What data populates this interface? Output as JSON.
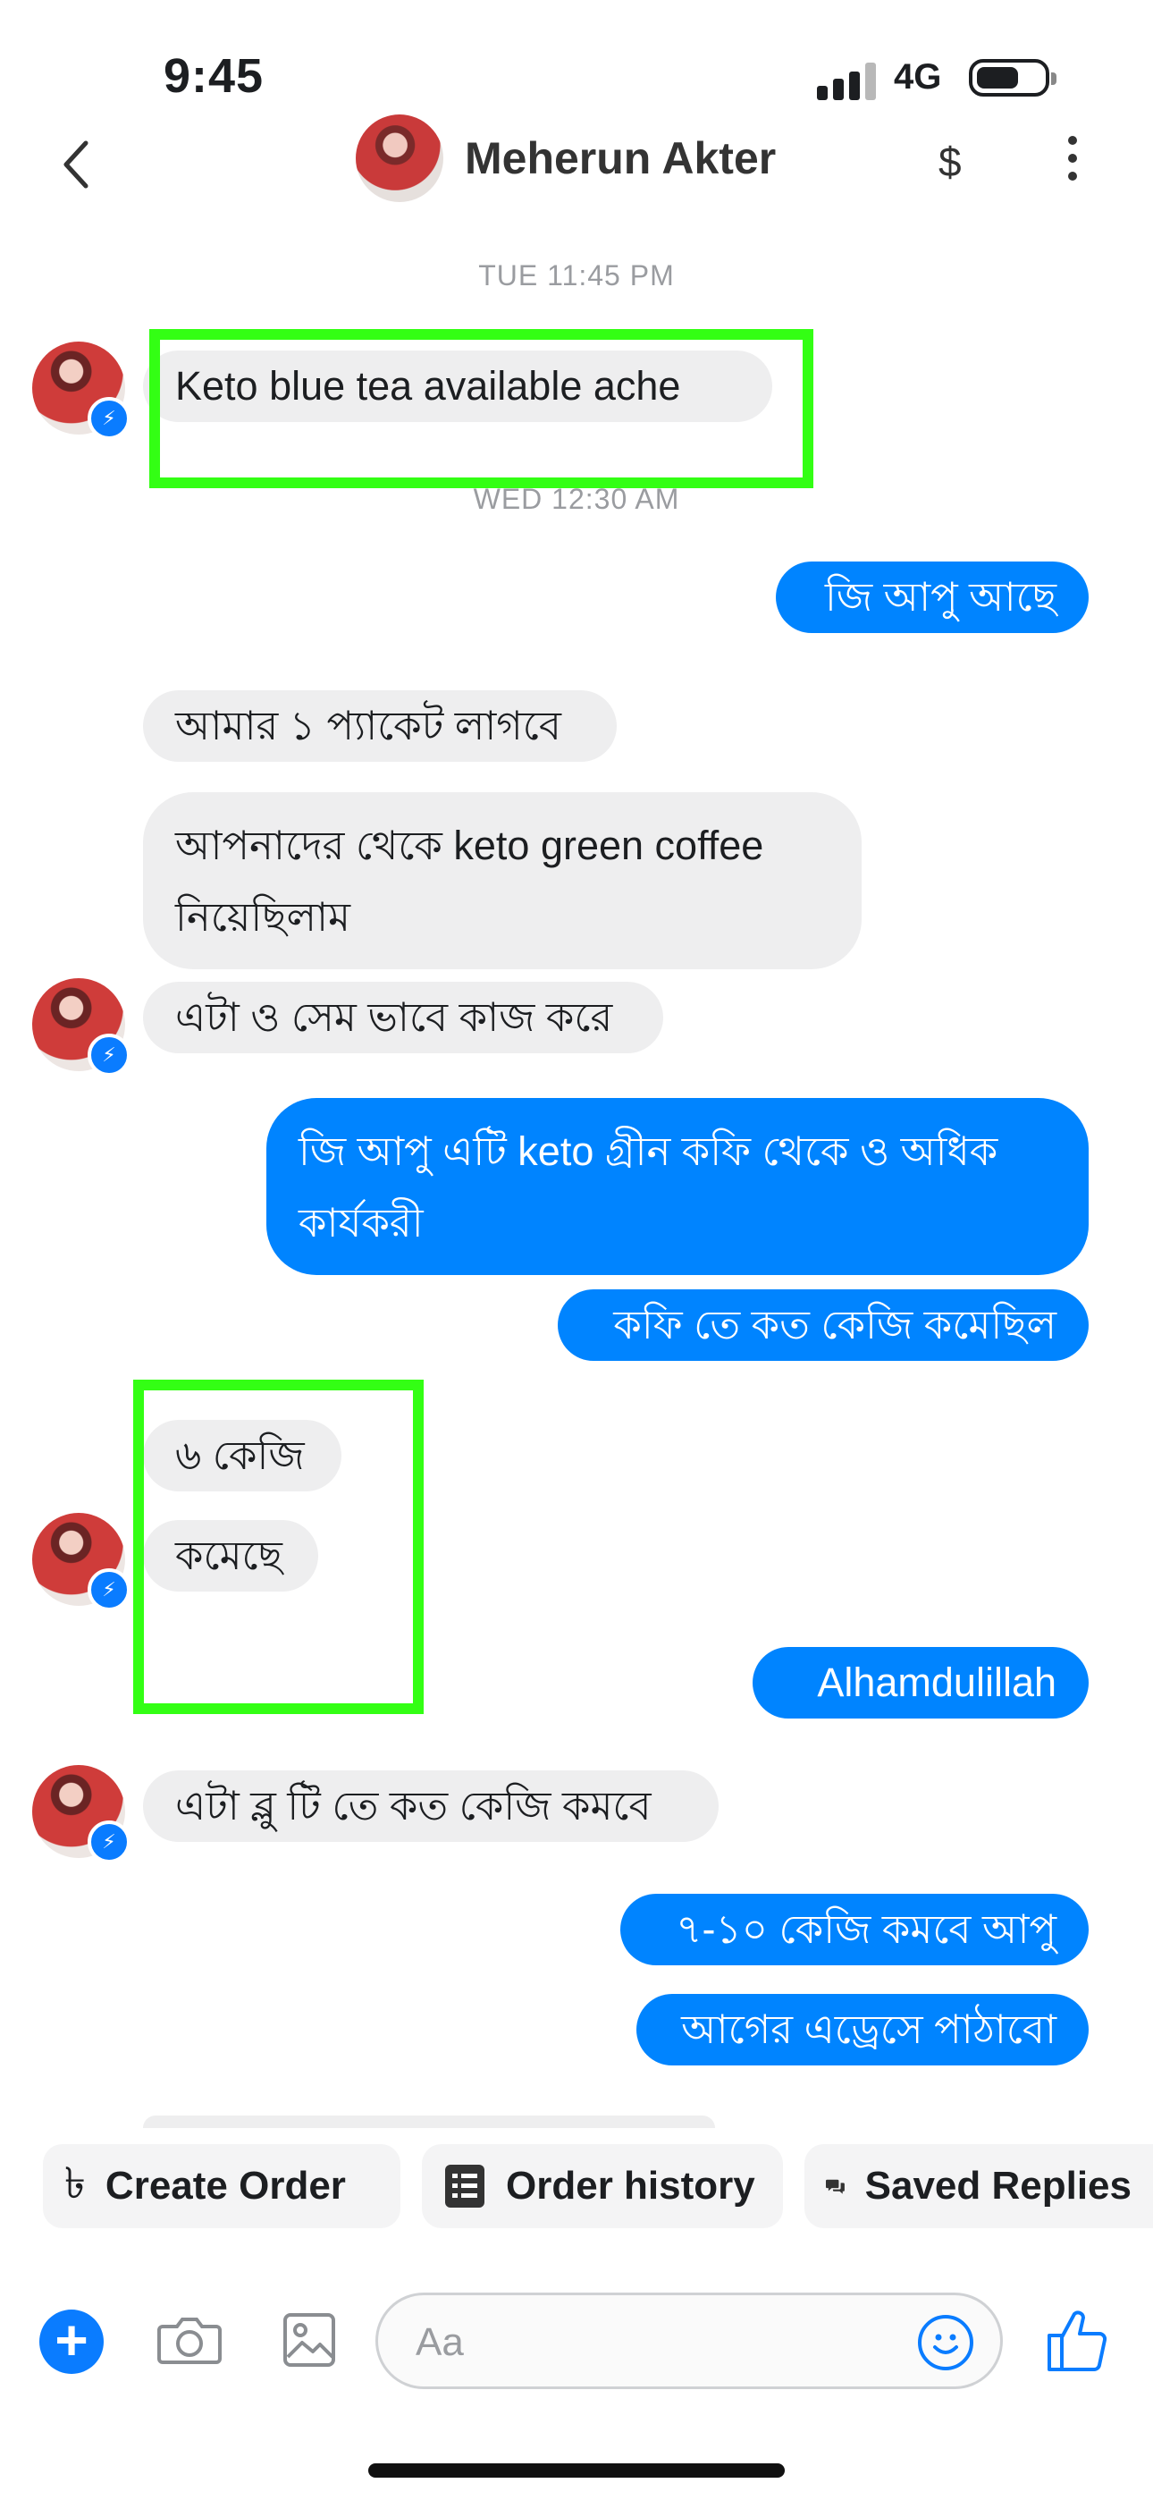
{
  "status_bar": {
    "time": "9:45",
    "network": "4G"
  },
  "header": {
    "contact_name": "Meherun Akter",
    "dollar_label": "$"
  },
  "thread": {
    "timestamps": [
      "TUE 11:45 PM",
      "WED 12:30 AM"
    ],
    "messages": [
      {
        "side": "in",
        "text": "Keto blue tea available ache"
      },
      {
        "side": "out",
        "text": "জি আপু আছে"
      },
      {
        "side": "in",
        "text": "আমার ১ প্যাকেট লাগবে"
      },
      {
        "side": "in",
        "text": "আপনাদের থেকে keto green coffee নিয়েছিলাম"
      },
      {
        "side": "in",
        "text": "এটা ও সেম ভাবে কাজ করে"
      },
      {
        "side": "out",
        "text": "জি আপু এটি keto গ্রীন কফি থেকে ও অধিক কার্যকরী"
      },
      {
        "side": "out",
        "text": "কফি তে কত কেজি কমেছিল"
      },
      {
        "side": "in",
        "text": "৬ কেজি"
      },
      {
        "side": "in",
        "text": "কমেছে"
      },
      {
        "side": "out",
        "text": "Alhamdulillah"
      },
      {
        "side": "in",
        "text": "এটা ব্লু টি তে কত কেজি কমবে"
      },
      {
        "side": "out",
        "text": "৭-১০ কেজি কমবে আপু"
      },
      {
        "side": "out",
        "text": "আগের এড্রেসে পাঠাবো"
      }
    ]
  },
  "quick_actions": [
    {
      "label": "Create Order",
      "icon": "taka-icon"
    },
    {
      "label": "Order history",
      "icon": "list-icon"
    },
    {
      "label": "Saved Replies",
      "icon": "chat-bubbles-icon"
    }
  ],
  "composer": {
    "placeholder": "Aa"
  },
  "colors": {
    "outgoing_bubble": "#0084ff",
    "incoming_bubble": "#eeeeef",
    "highlight_box": "#33ff14",
    "accent": "#0a7cff"
  }
}
